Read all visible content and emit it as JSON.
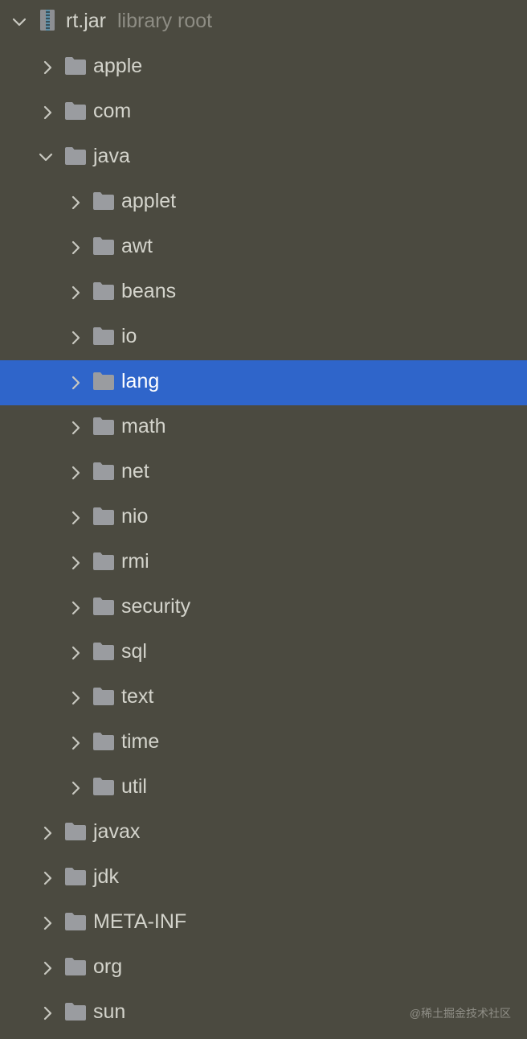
{
  "tree": {
    "root": {
      "label": "rt.jar",
      "hint": "library root",
      "icon": "jar-icon",
      "expanded": true
    },
    "items": [
      {
        "label": "apple",
        "depth": 1,
        "expanded": false
      },
      {
        "label": "com",
        "depth": 1,
        "expanded": false
      },
      {
        "label": "java",
        "depth": 1,
        "expanded": true
      },
      {
        "label": "applet",
        "depth": 2,
        "expanded": false
      },
      {
        "label": "awt",
        "depth": 2,
        "expanded": false
      },
      {
        "label": "beans",
        "depth": 2,
        "expanded": false
      },
      {
        "label": "io",
        "depth": 2,
        "expanded": false
      },
      {
        "label": "lang",
        "depth": 2,
        "expanded": false,
        "selected": true
      },
      {
        "label": "math",
        "depth": 2,
        "expanded": false
      },
      {
        "label": "net",
        "depth": 2,
        "expanded": false
      },
      {
        "label": "nio",
        "depth": 2,
        "expanded": false
      },
      {
        "label": "rmi",
        "depth": 2,
        "expanded": false
      },
      {
        "label": "security",
        "depth": 2,
        "expanded": false
      },
      {
        "label": "sql",
        "depth": 2,
        "expanded": false
      },
      {
        "label": "text",
        "depth": 2,
        "expanded": false
      },
      {
        "label": "time",
        "depth": 2,
        "expanded": false
      },
      {
        "label": "util",
        "depth": 2,
        "expanded": false
      },
      {
        "label": "javax",
        "depth": 1,
        "expanded": false
      },
      {
        "label": "jdk",
        "depth": 1,
        "expanded": false
      },
      {
        "label": "META-INF",
        "depth": 1,
        "expanded": false
      },
      {
        "label": "org",
        "depth": 1,
        "expanded": false
      },
      {
        "label": "sun",
        "depth": 1,
        "expanded": false
      }
    ]
  },
  "watermark": "@稀土掘金技术社区",
  "colors": {
    "background": "#4b4a40",
    "selection": "#2f65ca",
    "folder": "#9a9ca0",
    "text": "#d4d4cc",
    "hint": "#8e8d84"
  }
}
